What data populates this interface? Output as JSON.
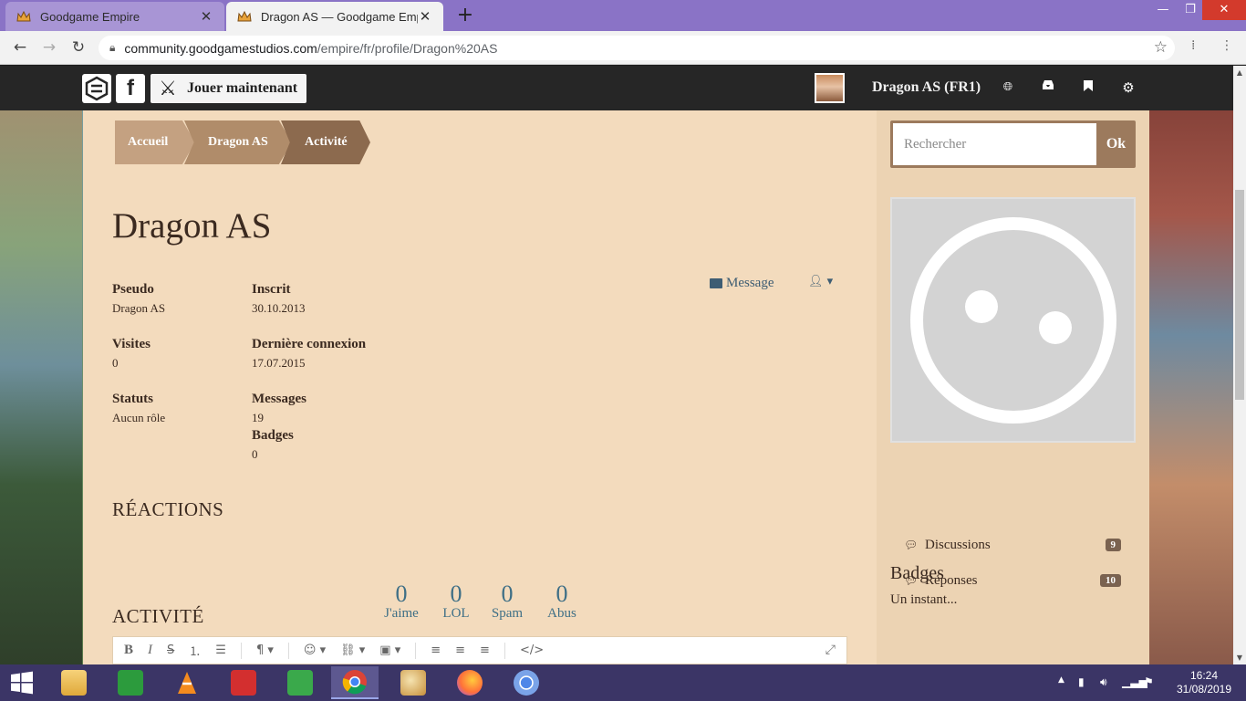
{
  "browser": {
    "tabs": [
      {
        "title": "Goodgame Empire",
        "active": false
      },
      {
        "title": "Dragon AS — Goodgame Empire",
        "active": true
      }
    ],
    "url_host": "community.goodgamestudios.com",
    "url_path": "/empire/fr/profile/Dragon%20AS"
  },
  "sitenav": {
    "play_label": "Jouer maintenant",
    "user_label": "Dragon AS (FR1)"
  },
  "breadcrumb": [
    "Accueil",
    "Dragon AS",
    "Activité"
  ],
  "profile": {
    "title": "Dragon AS",
    "fields": {
      "pseudo_k": "Pseudo",
      "pseudo_v": "Dragon AS",
      "inscrit_k": "Inscrit",
      "inscrit_v": "30.10.2013",
      "visites_k": "Visites",
      "visites_v": "0",
      "derniere_k": "Dernière connexion",
      "derniere_v": "17.07.2015",
      "statuts_k": "Statuts",
      "statuts_v": "Aucun rôle",
      "messages_k": "Messages",
      "messages_v": "19",
      "badges_k": "Badges",
      "badges_v": "0"
    },
    "message_label": "Message"
  },
  "reactions": {
    "heading": "RÉACTIONS",
    "items": [
      {
        "count": "0",
        "label": "J'aime"
      },
      {
        "count": "0",
        "label": "LOL"
      },
      {
        "count": "0",
        "label": "Spam"
      },
      {
        "count": "0",
        "label": "Abus"
      }
    ]
  },
  "activity": {
    "heading": "ACTIVITÉ",
    "toolbar_icons": [
      "bold-icon",
      "italic-icon",
      "strikethrough-icon",
      "ordered-list-icon",
      "bullet-list-icon",
      "paragraph-icon",
      "emoji-icon",
      "link-icon",
      "image-icon",
      "align-left-icon",
      "align-center-icon",
      "align-right-icon",
      "code-icon",
      "expand-icon"
    ]
  },
  "sidebar": {
    "search_placeholder": "Rechercher",
    "search_button": "Ok",
    "stats": [
      {
        "label": "Discussions",
        "count": "9"
      },
      {
        "label": "Réponses",
        "count": "10"
      }
    ],
    "badges_heading": "Badges",
    "badges_text": "Un instant..."
  },
  "taskbar": {
    "time": "16:24",
    "date": "31/08/2019"
  },
  "colors": {
    "content_bg": "#f3dbbd",
    "sidebar_bg": "#ecd3b3",
    "accent_link": "#3e5d73",
    "reaction_num": "#3e6f86",
    "topnav": "#262626"
  }
}
